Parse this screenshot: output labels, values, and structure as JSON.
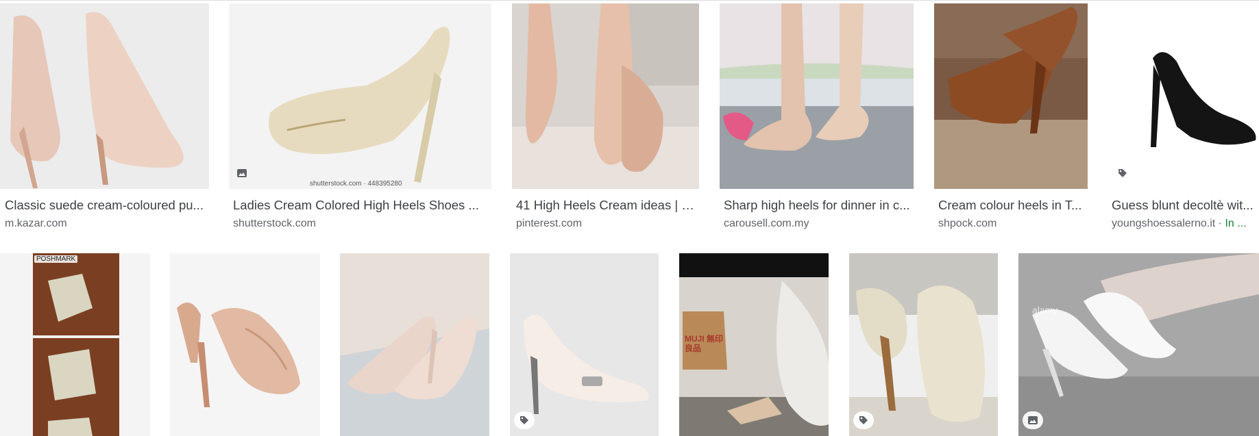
{
  "row1": [
    {
      "caption": "Classic suede cream-coloured pu...",
      "source": "m.kazar.com"
    },
    {
      "caption": "Ladies Cream Colored High Heels Shoes ...",
      "source": "shutterstock.com",
      "watermark": "shutterstock.com · 448395280",
      "badge": "image-icon"
    },
    {
      "caption": "41 High Heels Cream ideas | h...",
      "source": "pinterest.com"
    },
    {
      "caption": "Sharp high heels for dinner in c...",
      "source": "carousell.com.my"
    },
    {
      "caption": "Cream colour heels in T...",
      "source": "shpock.com"
    },
    {
      "caption": "Guess blunt decoltè wit...",
      "source": "youngshoessalerno.it",
      "extra": "· In ...",
      "badge": "tag-icon"
    }
  ],
  "row2": [
    {
      "label": "POSHMARK"
    },
    {},
    {},
    {
      "badge": "tag-icon"
    },
    {
      "label": "MUJI 無印良品"
    },
    {
      "badge": "tag-icon"
    },
    {
      "watermark": "alamy",
      "badge": "image-icon"
    }
  ],
  "colors": {
    "caption": "#3c4043",
    "source": "#5f6368",
    "in_stock": "#188038"
  }
}
